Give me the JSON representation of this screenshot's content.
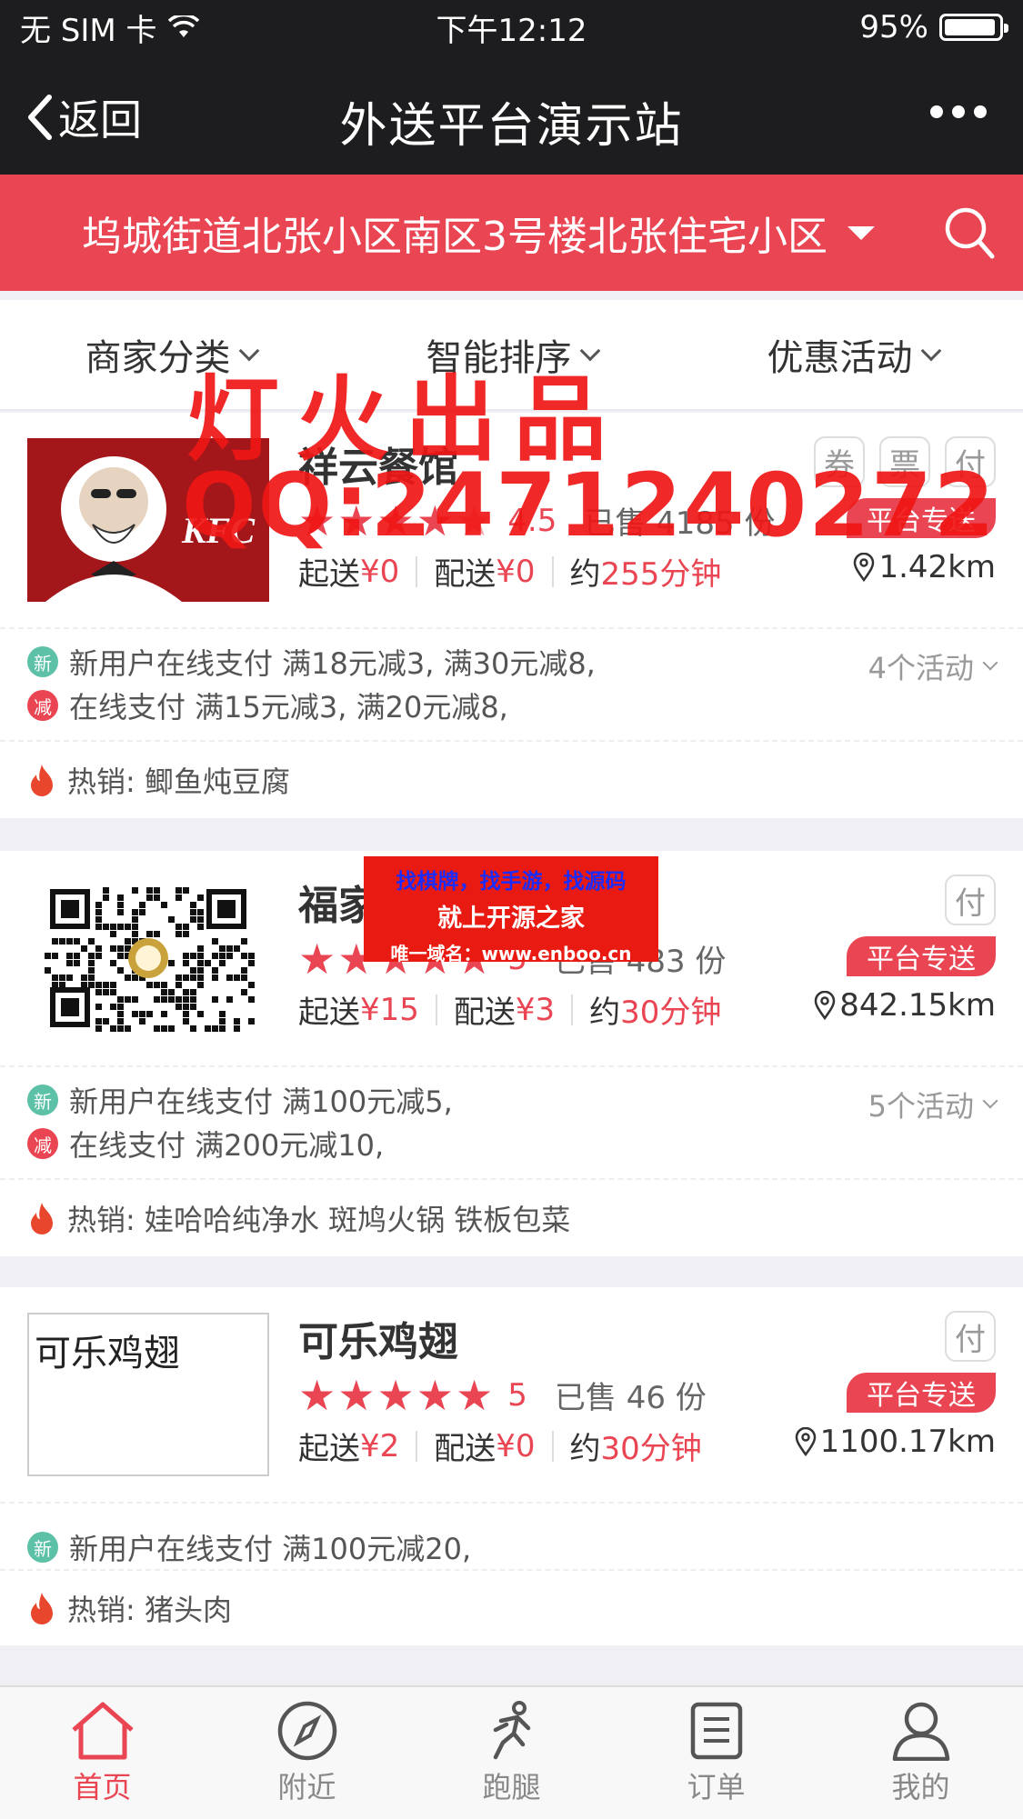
{
  "status": {
    "carrier": "无 SIM 卡",
    "time": "下午12:12",
    "battery": "95%",
    "battery_level": 0.95
  },
  "nav": {
    "back": "返回",
    "title": "外送平台演示站"
  },
  "address": "坞城街道北张小区南区3号楼北张住宅小区",
  "filters": [
    "商家分类",
    "智能排序",
    "优惠活动"
  ],
  "watermark": {
    "line1": "灯火出品",
    "line2": "QQ:2471240272"
  },
  "ad": {
    "line1": "找棋牌，找手游，找源码",
    "line2": "就上开源之家",
    "line3": "唯一域名：www.enboo.cn"
  },
  "shops": [
    {
      "name": "祥云餐馆",
      "logo": "KFC",
      "tags": [
        "券",
        "票",
        "付"
      ],
      "stars": 4.5,
      "score": "4.5",
      "sold": "已售 4185 份",
      "badge": "平台专送",
      "min_label": "起送",
      "min": "¥0",
      "fee_label": "配送",
      "fee": "¥0",
      "time_label": "约",
      "time": "255分钟",
      "distance": "1.42km",
      "promos": [
        {
          "type": "新",
          "text": "新用户在线支付 满18元减3, 满30元减8,"
        },
        {
          "type": "减",
          "text": "在线支付 满15元减3, 满20元减8,"
        }
      ],
      "activities": "4个活动",
      "hot": "热销: 鲫鱼炖豆腐"
    },
    {
      "name": "福家",
      "logo": "",
      "tags": [
        "付"
      ],
      "stars": 5,
      "score": "5",
      "sold": "已售 483 份",
      "badge": "平台专送",
      "min_label": "起送",
      "min": "¥15",
      "fee_label": "配送",
      "fee": "¥3",
      "time_label": "约",
      "time": "30分钟",
      "distance": "842.15km",
      "promos": [
        {
          "type": "新",
          "text": "新用户在线支付 满100元减5,"
        },
        {
          "type": "减",
          "text": "在线支付 满200元减10,"
        }
      ],
      "activities": "5个活动",
      "hot": "热销: 娃哈哈纯净水 斑鸠火锅 铁板包菜"
    },
    {
      "name": "可乐鸡翅",
      "logo": "可乐鸡翅",
      "tags": [
        "付"
      ],
      "stars": 5,
      "score": "5",
      "sold": "已售 46 份",
      "badge": "平台专送",
      "min_label": "起送",
      "min": "¥2",
      "fee_label": "配送",
      "fee": "¥0",
      "time_label": "约",
      "time": "30分钟",
      "distance": "1100.17km",
      "promos": [
        {
          "type": "新",
          "text": "新用户在线支付 满100元减20,"
        }
      ],
      "activities": "",
      "hot": "热销: 猪头肉"
    }
  ],
  "tabs": [
    {
      "label": "首页",
      "icon": "home-icon",
      "active": true
    },
    {
      "label": "附近",
      "icon": "compass-icon",
      "active": false
    },
    {
      "label": "跑腿",
      "icon": "runner-icon",
      "active": false
    },
    {
      "label": "订单",
      "icon": "order-icon",
      "active": false
    },
    {
      "label": "我的",
      "icon": "user-icon",
      "active": false
    }
  ],
  "colors": {
    "accent": "#e94552",
    "nav_bg": "#1d1d1f",
    "promo_new": "#5cc1a6"
  }
}
